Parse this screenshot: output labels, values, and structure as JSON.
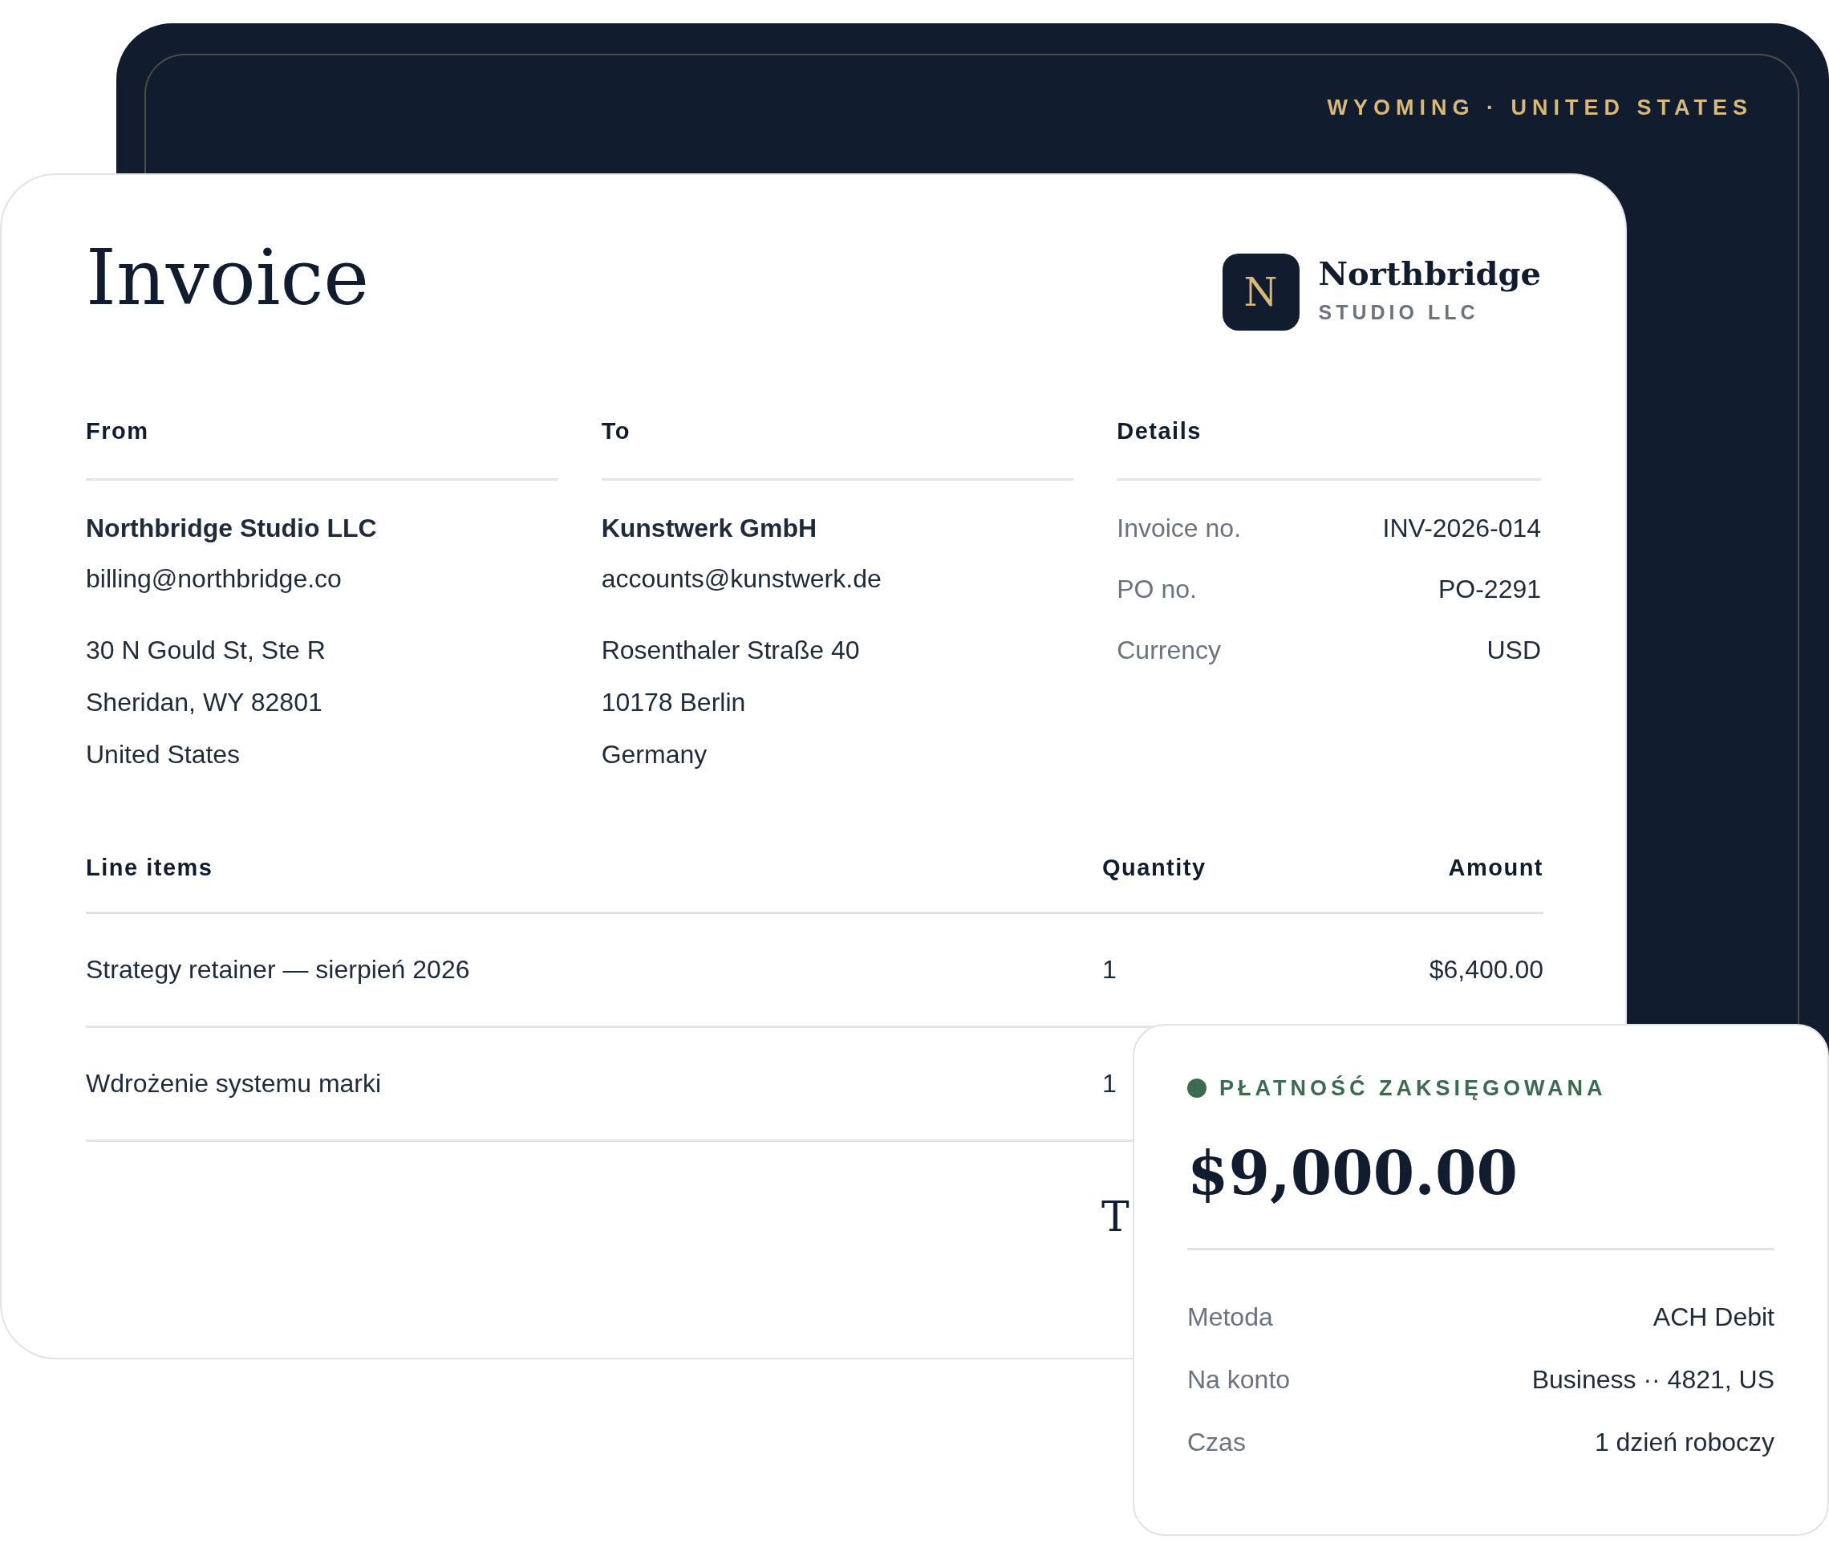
{
  "region_label": "WYOMING · UNITED STATES",
  "invoice": {
    "title": "Invoice",
    "logo": {
      "letter": "N",
      "name": "Northbridge",
      "subtitle": "STUDIO LLC"
    },
    "parties": [
      {
        "heading": "From",
        "name": "Northbridge Studio LLC",
        "email": "billing@northbridge.co",
        "address": [
          "30 N Gould St, Ste R",
          "Sheridan, WY 82801",
          "United States"
        ]
      },
      {
        "heading": "To",
        "name": "Kunstwerk GmbH",
        "email": "accounts@kunstwerk.de",
        "address": [
          "Rosenthaler Straße 40",
          "10178 Berlin",
          "Germany"
        ]
      }
    ],
    "details": {
      "heading": "Details",
      "rows": [
        {
          "label": "Invoice no.",
          "value": "INV-2026-014"
        },
        {
          "label": "PO no.",
          "value": "PO-2291"
        },
        {
          "label": "Currency",
          "value": "USD"
        }
      ]
    },
    "line_items": {
      "columns": [
        "Line items",
        "Quantity",
        "Amount"
      ],
      "rows": [
        {
          "description": "Strategy retainer — sierpień 2026",
          "quantity": "1",
          "amount": "$6,400.00"
        },
        {
          "description": "Wdrożenie systemu marki",
          "quantity": "1"
        }
      ]
    },
    "total_label": "T"
  },
  "payment": {
    "status": "PŁATNOŚĆ ZAKSIĘGOWANA",
    "amount": "$9,000.00",
    "rows": [
      {
        "label": "Metoda",
        "value": "ACH Debit"
      },
      {
        "label": "Na konto",
        "value": "Business ·· 4821, US"
      },
      {
        "label": "Czas",
        "value": "1 dzień roboczy"
      }
    ]
  }
}
